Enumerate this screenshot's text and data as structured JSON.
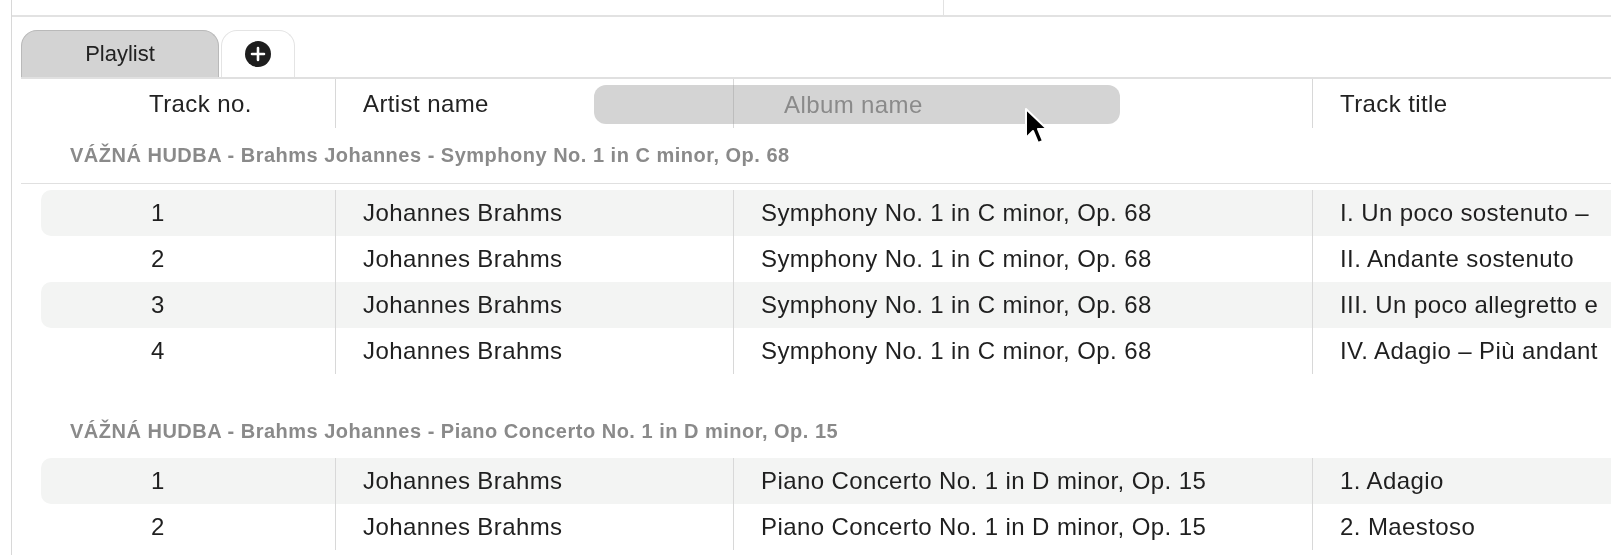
{
  "tabs": [
    {
      "kind": "text",
      "label": "Playlist",
      "selected": true
    },
    {
      "kind": "add",
      "selected": false
    }
  ],
  "columns": [
    {
      "label": "Track no.",
      "dragging": false
    },
    {
      "label": "Artist name",
      "dragging": false
    },
    {
      "label": "Album name",
      "dragging": true
    },
    {
      "label": "Track title",
      "dragging": false
    }
  ],
  "groups": [
    {
      "title": "VÁŽNÁ HUDBA - Brahms Johannes - Symphony No. 1 in C minor, Op. 68",
      "rows": [
        [
          "1",
          "Johannes Brahms",
          "Symphony No. 1 in C minor, Op. 68",
          "I. Un poco sostenuto –"
        ],
        [
          "2",
          "Johannes Brahms",
          "Symphony No. 1 in C minor, Op. 68",
          "II. Andante sostenuto"
        ],
        [
          "3",
          "Johannes Brahms",
          "Symphony No. 1 in C minor, Op. 68",
          "III. Un poco allegretto e"
        ],
        [
          "4",
          "Johannes Brahms",
          "Symphony No. 1 in C minor, Op. 68",
          "IV. Adagio – Più andant"
        ]
      ]
    },
    {
      "title": "VÁŽNÁ HUDBA - Brahms Johannes - Piano Concerto No. 1 in D minor, Op. 15",
      "rows": [
        [
          "1",
          "Johannes Brahms",
          "Piano Concerto No. 1 in D minor, Op. 15",
          "1. Adagio"
        ],
        [
          "2",
          "Johannes Brahms",
          "Piano Concerto No. 1 in D minor, Op. 15",
          "2. Maestoso"
        ]
      ]
    }
  ]
}
